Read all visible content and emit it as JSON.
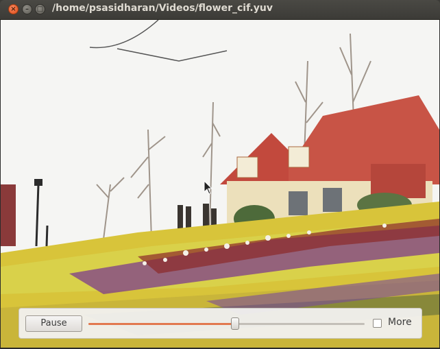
{
  "window": {
    "title": "/home/psasidharan/Videos/flower_cif.yuv",
    "close_glyph": "×",
    "minimize_glyph": "–",
    "maximize_glyph": "□"
  },
  "video": {
    "content_icon": "flower-garden-video-frame"
  },
  "controls": {
    "pause_label": "Pause",
    "progress_fraction": 0.53,
    "more_label": "More",
    "more_checked": false
  },
  "colors": {
    "slider_fill": "#e2784f",
    "close_button": "#df4a16"
  }
}
